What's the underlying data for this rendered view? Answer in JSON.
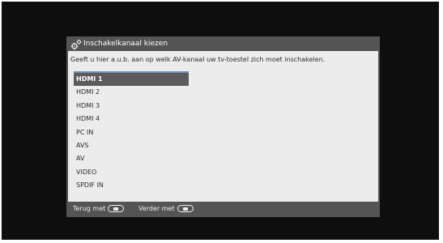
{
  "dialog": {
    "title": "Inschakelkanaal kiezen",
    "title_icon": "settings-gears-icon",
    "instruction": "Geeft u hier a.u.b. aan op welk AV-kanaal uw tv-toestel zich moet inschakelen."
  },
  "channels": {
    "selected": "HDMI 1",
    "items": [
      {
        "label": "HDMI 1"
      },
      {
        "label": "HDMI 2"
      },
      {
        "label": "HDMI 3"
      },
      {
        "label": "HDMI 4"
      },
      {
        "label": "PC IN"
      },
      {
        "label": "AVS"
      },
      {
        "label": "AV"
      },
      {
        "label": "VIDEO"
      },
      {
        "label": "SPDIF IN"
      }
    ]
  },
  "footer": {
    "back_label": "Terug met",
    "back_icon": "remote-back-key-icon",
    "next_label": "Verder met",
    "next_icon": "remote-forward-key-icon"
  },
  "colors": {
    "screen_background": "#0e0e0e",
    "dialog_frame": "#545454",
    "dialog_body": "#ececec",
    "selection_highlight": "#5b5b5b",
    "selection_accent": "#6e8fb8"
  }
}
